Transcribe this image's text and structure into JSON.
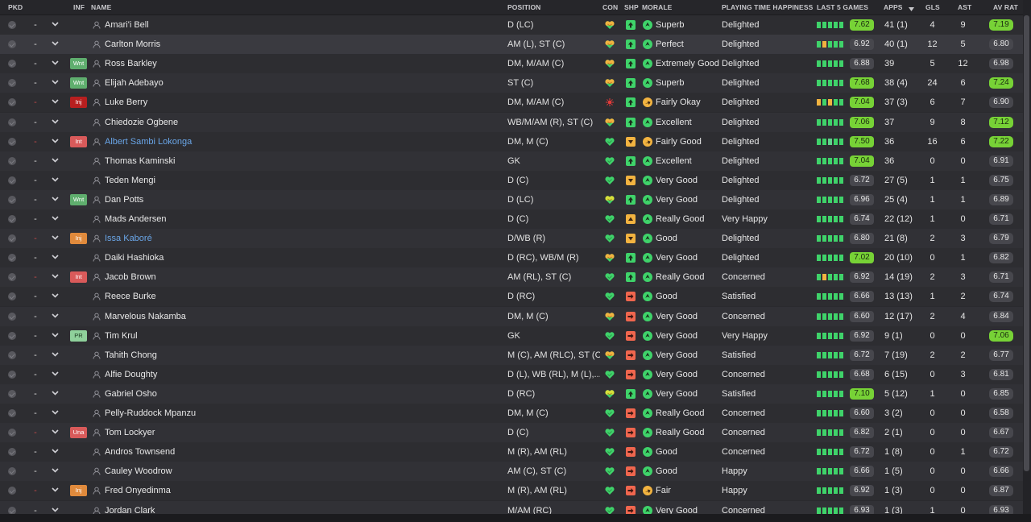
{
  "columns": {
    "pkd": "PKD",
    "inf": "INF",
    "name": "NAME",
    "position": "POSITION",
    "con": "CON",
    "shp": "SHP",
    "morale": "MORALE",
    "pth": "PLAYING TIME HAPPINESS",
    "last5": "LAST 5 GAMES",
    "apps": "APPS",
    "gls": "GLS",
    "ast": "AST",
    "avrat": "AV RAT"
  },
  "colors": {
    "green": "#77d236",
    "up": "#3ccf62",
    "mid": "#f2b340",
    "down": "#f0664e",
    "link": "#6aa6e8"
  },
  "rows": [
    {
      "name": "Amari'i Bell",
      "pos": "D (LC)",
      "badge": "",
      "dash": "-",
      "con": "half",
      "shp": "green",
      "mi": "up",
      "morale": "Superb",
      "pth": "Delighted",
      "bars": [
        "g",
        "g",
        "g",
        "g",
        "g"
      ],
      "l5": "7.62",
      "l5g": true,
      "apps": "41 (1)",
      "gls": "4",
      "ast": "9",
      "avr": "7.19",
      "avrg": true
    },
    {
      "name": "Carlton Morris",
      "pos": "AM (L), ST (C)",
      "badge": "",
      "dash": "-",
      "con": "half",
      "shp": "green",
      "mi": "up",
      "morale": "Perfect",
      "pth": "Delighted",
      "bars": [
        "g",
        "y",
        "g",
        "g",
        "g"
      ],
      "l5": "6.92",
      "l5g": false,
      "apps": "40 (1)",
      "gls": "12",
      "ast": "5",
      "avr": "6.80",
      "avrg": false
    },
    {
      "name": "Ross Barkley",
      "pos": "DM, M/AM (C)",
      "badge": "Wnt",
      "dash": "-",
      "con": "half",
      "shp": "green",
      "mi": "up",
      "morale": "Extremely Good",
      "pth": "Delighted",
      "bars": [
        "g",
        "g",
        "g",
        "g",
        "g"
      ],
      "l5": "6.88",
      "l5g": false,
      "apps": "39",
      "gls": "5",
      "ast": "12",
      "avr": "6.98",
      "avrg": false
    },
    {
      "name": "Elijah Adebayo",
      "pos": "ST (C)",
      "badge": "Wnt",
      "dash": "-",
      "con": "half",
      "shp": "green",
      "mi": "up",
      "morale": "Superb",
      "pth": "Delighted",
      "bars": [
        "g",
        "g",
        "g",
        "g",
        "g"
      ],
      "l5": "7.68",
      "l5g": true,
      "apps": "38 (4)",
      "gls": "24",
      "ast": "6",
      "avr": "7.24",
      "avrg": true
    },
    {
      "name": "Luke Berry",
      "pos": "DM, M/AM (C)",
      "badge": "Inj",
      "dash": "-",
      "con": "inj",
      "shp": "green",
      "mi": "mid",
      "morale": "Fairly Okay",
      "pth": "Delighted",
      "bars": [
        "y",
        "g",
        "y",
        "g",
        "g"
      ],
      "l5": "7.04",
      "l5g": true,
      "apps": "37 (3)",
      "gls": "6",
      "ast": "7",
      "avr": "6.90",
      "avrg": false
    },
    {
      "name": "Chiedozie Ogbene",
      "pos": "WB/M/AM (R), ST (C)",
      "badge": "",
      "dash": "-",
      "con": "half",
      "shp": "green",
      "mi": "up",
      "morale": "Excellent",
      "pth": "Delighted",
      "bars": [
        "g",
        "g",
        "g",
        "g",
        "g"
      ],
      "l5": "7.06",
      "l5g": true,
      "apps": "37",
      "gls": "9",
      "ast": "8",
      "avr": "7.12",
      "avrg": true
    },
    {
      "name": "Albert Sambi Lokonga",
      "pos": "DM, M (C)",
      "badge": "Int",
      "dash": "-",
      "con": "full",
      "shp": "yellow",
      "mi": "mid",
      "morale": "Fairly Good",
      "pth": "Delighted",
      "bars": [
        "g",
        "g",
        "b",
        "g",
        "g"
      ],
      "l5": "7.50",
      "l5g": true,
      "apps": "36",
      "gls": "16",
      "ast": "6",
      "avr": "7.22",
      "avrg": true,
      "link": true
    },
    {
      "name": "Thomas Kaminski",
      "pos": "GK",
      "badge": "",
      "dash": "-",
      "con": "full",
      "shp": "green",
      "mi": "up",
      "morale": "Excellent",
      "pth": "Delighted",
      "bars": [
        "g",
        "g",
        "g",
        "g",
        "g"
      ],
      "l5": "7.04",
      "l5g": true,
      "apps": "36",
      "gls": "0",
      "ast": "0",
      "avr": "6.91",
      "avrg": false
    },
    {
      "name": "Teden Mengi",
      "pos": "D (C)",
      "badge": "",
      "dash": "-",
      "con": "full",
      "shp": "yellow",
      "mi": "up",
      "morale": "Very Good",
      "pth": "Delighted",
      "bars": [
        "g",
        "g",
        "g",
        "g",
        "g"
      ],
      "l5": "6.72",
      "l5g": false,
      "apps": "27 (5)",
      "gls": "1",
      "ast": "1",
      "avr": "6.75",
      "avrg": false
    },
    {
      "name": "Dan Potts",
      "pos": "D (LC)",
      "badge": "Wnt",
      "dash": "-",
      "con": "half2",
      "shp": "green",
      "mi": "up",
      "morale": "Very Good",
      "pth": "Delighted",
      "bars": [
        "g",
        "g",
        "g",
        "g",
        "g"
      ],
      "l5": "6.96",
      "l5g": false,
      "apps": "25 (4)",
      "gls": "1",
      "ast": "1",
      "avr": "6.89",
      "avrg": false
    },
    {
      "name": "Mads Andersen",
      "pos": "D (C)",
      "badge": "",
      "dash": "-",
      "con": "full",
      "shp": "down",
      "mi": "up",
      "morale": "Really Good",
      "pth": "Very Happy",
      "bars": [
        "g",
        "g",
        "g",
        "g",
        "g"
      ],
      "l5": "6.74",
      "l5g": false,
      "apps": "22 (12)",
      "gls": "1",
      "ast": "0",
      "avr": "6.71",
      "avrg": false
    },
    {
      "name": "Issa Kaboré",
      "pos": "D/WB (R)",
      "badge": "Inj2",
      "dash": "-",
      "con": "full",
      "shp": "yellow",
      "mi": "up",
      "morale": "Good",
      "pth": "Delighted",
      "bars": [
        "g",
        "g",
        "g",
        "g",
        "g"
      ],
      "l5": "6.80",
      "l5g": false,
      "apps": "21 (8)",
      "gls": "2",
      "ast": "3",
      "avr": "6.79",
      "avrg": false,
      "link": true
    },
    {
      "name": "Daiki Hashioka",
      "pos": "D (RC), WB/M (R)",
      "badge": "",
      "dash": "-",
      "con": "half",
      "shp": "green",
      "mi": "up",
      "morale": "Very Good",
      "pth": "Delighted",
      "bars": [
        "g",
        "g",
        "g",
        "g",
        "g"
      ],
      "l5": "7.02",
      "l5g": true,
      "apps": "20 (10)",
      "gls": "0",
      "ast": "1",
      "avr": "6.82",
      "avrg": false
    },
    {
      "name": "Jacob Brown",
      "pos": "AM (RL), ST (C)",
      "badge": "Int",
      "dash": "-",
      "con": "full",
      "shp": "green",
      "mi": "up",
      "morale": "Really Good",
      "pth": "Concerned",
      "bars": [
        "g",
        "y",
        "g",
        "g",
        "g"
      ],
      "l5": "6.92",
      "l5g": false,
      "apps": "14 (19)",
      "gls": "2",
      "ast": "3",
      "avr": "6.71",
      "avrg": false
    },
    {
      "name": "Reece Burke",
      "pos": "D (RC)",
      "badge": "",
      "dash": "-",
      "con": "full",
      "shp": "red",
      "mi": "up",
      "morale": "Good",
      "pth": "Satisfied",
      "bars": [
        "g",
        "g",
        "g",
        "g",
        "g"
      ],
      "l5": "6.66",
      "l5g": false,
      "apps": "13 (13)",
      "gls": "1",
      "ast": "2",
      "avr": "6.74",
      "avrg": false
    },
    {
      "name": "Marvelous Nakamba",
      "pos": "DM, M (C)",
      "badge": "",
      "dash": "-",
      "con": "half",
      "shp": "red",
      "mi": "up",
      "morale": "Very Good",
      "pth": "Concerned",
      "bars": [
        "g",
        "g",
        "g",
        "g",
        "g"
      ],
      "l5": "6.60",
      "l5g": false,
      "apps": "12 (17)",
      "gls": "2",
      "ast": "4",
      "avr": "6.84",
      "avrg": false
    },
    {
      "name": "Tim Krul",
      "pos": "GK",
      "badge": "PR",
      "dash": "-",
      "con": "full",
      "shp": "red",
      "mi": "up",
      "morale": "Very Good",
      "pth": "Very Happy",
      "bars": [
        "g",
        "g",
        "g",
        "g",
        "g"
      ],
      "l5": "6.92",
      "l5g": false,
      "apps": "9 (1)",
      "gls": "0",
      "ast": "0",
      "avr": "7.06",
      "avrg": true
    },
    {
      "name": "Tahith Chong",
      "pos": "M (C), AM (RLC), ST (C)",
      "badge": "",
      "dash": "-",
      "con": "half",
      "shp": "red",
      "mi": "up",
      "morale": "Very Good",
      "pth": "Satisfied",
      "bars": [
        "g",
        "g",
        "g",
        "g",
        "g"
      ],
      "l5": "6.72",
      "l5g": false,
      "apps": "7 (19)",
      "gls": "2",
      "ast": "2",
      "avr": "6.77",
      "avrg": false
    },
    {
      "name": "Alfie Doughty",
      "pos": "D (L), WB (RL), M (L),...",
      "badge": "",
      "dash": "-",
      "con": "full",
      "shp": "red",
      "mi": "up",
      "morale": "Very Good",
      "pth": "Concerned",
      "bars": [
        "g",
        "g",
        "g",
        "g",
        "g"
      ],
      "l5": "6.68",
      "l5g": false,
      "apps": "6 (15)",
      "gls": "0",
      "ast": "3",
      "avr": "6.81",
      "avrg": false
    },
    {
      "name": "Gabriel Osho",
      "pos": "D (RC)",
      "badge": "",
      "dash": "-",
      "con": "half2",
      "shp": "green",
      "mi": "up",
      "morale": "Very Good",
      "pth": "Satisfied",
      "bars": [
        "g",
        "g",
        "g",
        "g",
        "g"
      ],
      "l5": "7.10",
      "l5g": true,
      "apps": "5 (12)",
      "gls": "1",
      "ast": "0",
      "avr": "6.85",
      "avrg": false
    },
    {
      "name": "Pelly-Ruddock Mpanzu",
      "pos": "DM, M (C)",
      "badge": "",
      "dash": "-",
      "con": "full",
      "shp": "red",
      "mi": "up",
      "morale": "Really Good",
      "pth": "Concerned",
      "bars": [
        "g",
        "g",
        "g",
        "g",
        "g"
      ],
      "l5": "6.60",
      "l5g": false,
      "apps": "3 (2)",
      "gls": "0",
      "ast": "0",
      "avr": "6.58",
      "avrg": false
    },
    {
      "name": "Tom Lockyer",
      "pos": "D (C)",
      "badge": "Una",
      "dash": "-",
      "con": "full",
      "shp": "red",
      "mi": "up",
      "morale": "Really Good",
      "pth": "Concerned",
      "bars": [
        "g",
        "g",
        "g",
        "g",
        "g"
      ],
      "l5": "6.82",
      "l5g": false,
      "apps": "2 (1)",
      "gls": "0",
      "ast": "0",
      "avr": "6.67",
      "avrg": false
    },
    {
      "name": "Andros Townsend",
      "pos": "M (R), AM (RL)",
      "badge": "",
      "dash": "-",
      "con": "full",
      "shp": "red",
      "mi": "up",
      "morale": "Good",
      "pth": "Concerned",
      "bars": [
        "g",
        "g",
        "g",
        "g",
        "g"
      ],
      "l5": "6.72",
      "l5g": false,
      "apps": "1 (8)",
      "gls": "0",
      "ast": "1",
      "avr": "6.72",
      "avrg": false
    },
    {
      "name": "Cauley Woodrow",
      "pos": "AM (C), ST (C)",
      "badge": "",
      "dash": "-",
      "con": "full",
      "shp": "red",
      "mi": "up",
      "morale": "Good",
      "pth": "Happy",
      "bars": [
        "g",
        "g",
        "g",
        "g",
        "g"
      ],
      "l5": "6.66",
      "l5g": false,
      "apps": "1 (5)",
      "gls": "0",
      "ast": "0",
      "avr": "6.66",
      "avrg": false
    },
    {
      "name": "Fred Onyedinma",
      "pos": "M (R), AM (RL)",
      "badge": "Inj2",
      "dash": "-",
      "con": "full",
      "shp": "red",
      "mi": "mid",
      "morale": "Fair",
      "pth": "Happy",
      "bars": [
        "g",
        "g",
        "g",
        "g",
        "g"
      ],
      "l5": "6.92",
      "l5g": false,
      "apps": "1 (3)",
      "gls": "0",
      "ast": "0",
      "avr": "6.87",
      "avrg": false
    },
    {
      "name": "Jordan Clark",
      "pos": "M/AM (RC)",
      "badge": "",
      "dash": "-",
      "con": "full",
      "shp": "red",
      "mi": "up",
      "morale": "Very Good",
      "pth": "Concerned",
      "bars": [
        "g",
        "g",
        "g",
        "g",
        "g"
      ],
      "l5": "6.93",
      "l5g": false,
      "apps": "1 (3)",
      "gls": "1",
      "ast": "0",
      "avr": "6.93",
      "avrg": false
    }
  ],
  "badge_labels": {
    "Wnt": "Wnt",
    "Inj": "Inj",
    "Inj2": "Inj",
    "Int": "Int",
    "PR": "PR",
    "Una": "Una"
  }
}
